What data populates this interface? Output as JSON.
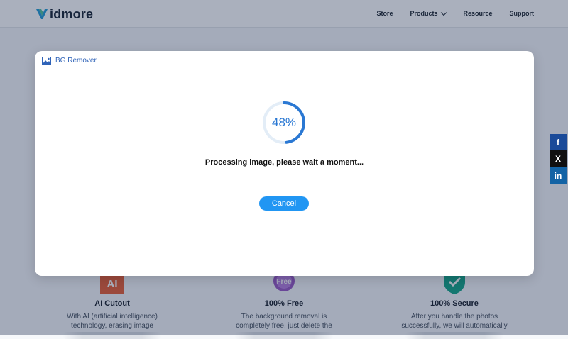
{
  "header": {
    "logo_text": "idmore",
    "nav": {
      "store": "Store",
      "products": "Products",
      "resource": "Resource",
      "support": "Support"
    }
  },
  "features": [
    {
      "badge": "AI",
      "title": "AI Cutout",
      "text": "With AI (artificial intelligence) technology, erasing image",
      "badge_color": "#e8623a"
    },
    {
      "badge": "Free",
      "title": "100% Free",
      "text": "The background removal is completely free, just delete the",
      "badge_color": "#9b5cc7"
    },
    {
      "badge": "",
      "title": "100% Secure",
      "text": "After you handle the photos successfully, we will automatically",
      "badge_color": "#1aa88a"
    }
  ],
  "social": {
    "facebook": "f",
    "x": "X",
    "linkedin": "in"
  },
  "modal": {
    "title": "BG Remover",
    "progress_label": "48%",
    "progress_value": 0.48,
    "message": "Processing image, please wait a moment...",
    "cancel_label": "Cancel"
  },
  "colors": {
    "accent": "#2196f3",
    "progress": "#2a78d3",
    "title": "#2f63b8"
  }
}
